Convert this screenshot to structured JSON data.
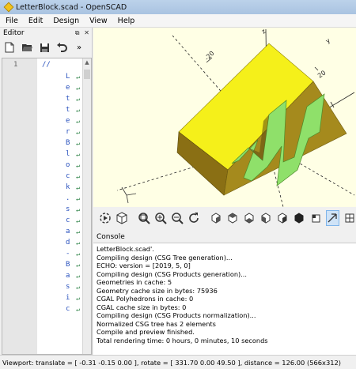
{
  "window": {
    "title": "LetterBlock.scad - OpenSCAD"
  },
  "menu": [
    "File",
    "Edit",
    "Design",
    "View",
    "Help"
  ],
  "editor": {
    "title": "Editor",
    "toolbar_icons": [
      "new-file-icon",
      "open-folder-icon",
      "save-icon",
      "undo-icon",
      "more-icon"
    ],
    "line_number": "1",
    "comment_start": "//",
    "wrapped_chars": [
      "L",
      "e",
      "t",
      "t",
      "e",
      "r",
      "B",
      "l",
      "o",
      "c",
      "k",
      ".",
      "s",
      "c",
      "a",
      "d",
      "-",
      "B",
      "a",
      "s",
      "i",
      "c"
    ]
  },
  "viewport": {
    "axis_labels": {
      "z": "z",
      "y": "y",
      "neg_x_label": "-20"
    },
    "colors": {
      "background": "#ffffe5",
      "cube_top": "#f5f01a",
      "cube_side": "#8a6f14",
      "cube_front": "#a58a1d",
      "letter": "#8fe06a"
    },
    "letter": "M"
  },
  "view_toolbar": [
    "preview-render-icon",
    "render-icon",
    "view-all-icon",
    "zoom-in-icon",
    "zoom-out-icon",
    "reset-view-icon",
    "view-right-icon",
    "view-top-icon",
    "view-bottom-icon",
    "view-left-icon",
    "view-front-icon",
    "view-back-icon",
    "view-diagonal-icon",
    "view-center-icon"
  ],
  "console": {
    "title": "Console",
    "lines": [
      "LetterBlock.scad'.",
      "Compiling design (CSG Tree generation)...",
      "ECHO: version = [2019, 5, 0]",
      "Compiling design (CSG Products generation)...",
      "Geometries in cache: 5",
      "Geometry cache size in bytes: 75936",
      "CGAL Polyhedrons in cache: 0",
      "CGAL cache size in bytes: 0",
      "Compiling design (CSG Products normalization)...",
      "Normalized CSG tree has 2 elements",
      "Compile and preview finished.",
      "Total rendering time: 0 hours, 0 minutes, 10 seconds"
    ]
  },
  "status": "Viewport: translate = [ -0.31 -0.15 0.00 ], rotate = [ 331.70 0.00 49.50 ], distance = 126.00 (566x312)"
}
